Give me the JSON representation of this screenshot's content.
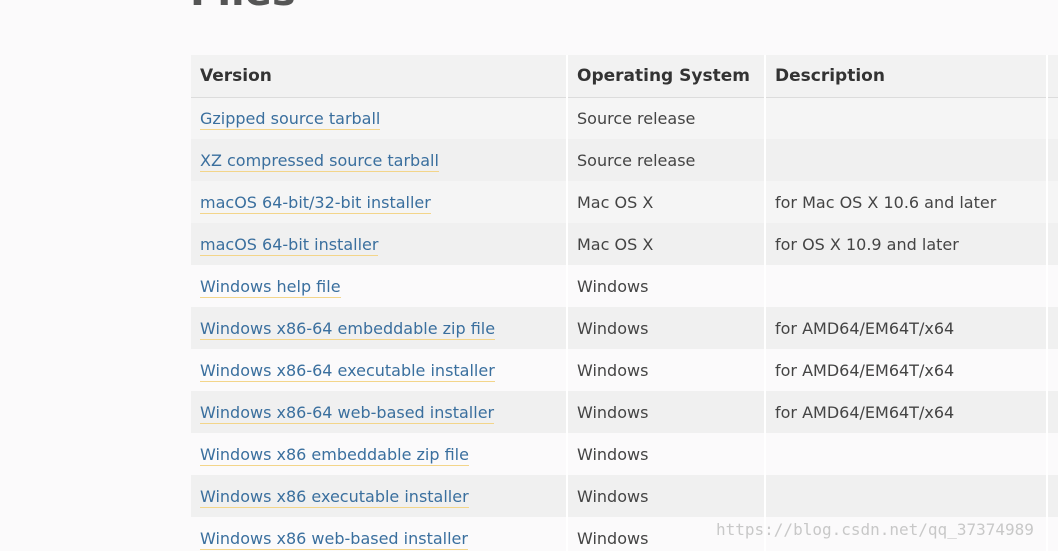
{
  "section": {
    "title": "Files"
  },
  "table": {
    "headers": [
      "Version",
      "Operating System",
      "Description",
      ""
    ],
    "rows": [
      {
        "version": "Gzipped source tarball",
        "os": "Source release",
        "description": ""
      },
      {
        "version": "XZ compressed source tarball",
        "os": "Source release",
        "description": ""
      },
      {
        "version": "macOS 64-bit/32-bit installer",
        "os": "Mac OS X",
        "description": "for Mac OS X 10.6 and later"
      },
      {
        "version": "macOS 64-bit installer",
        "os": "Mac OS X",
        "description": "for OS X 10.9 and later"
      },
      {
        "version": "Windows help file",
        "os": "Windows",
        "description": ""
      },
      {
        "version": "Windows x86-64 embeddable zip file",
        "os": "Windows",
        "description": "for AMD64/EM64T/x64"
      },
      {
        "version": "Windows x86-64 executable installer",
        "os": "Windows",
        "description": "for AMD64/EM64T/x64"
      },
      {
        "version": "Windows x86-64 web-based installer",
        "os": "Windows",
        "description": "for AMD64/EM64T/x64"
      },
      {
        "version": "Windows x86 embeddable zip file",
        "os": "Windows",
        "description": ""
      },
      {
        "version": "Windows x86 executable installer",
        "os": "Windows",
        "description": ""
      },
      {
        "version": "Windows x86 web-based installer",
        "os": "Windows",
        "description": ""
      }
    ]
  },
  "watermark": "https://blog.csdn.net/qq_37374989",
  "colors": {
    "link": "#3a6f9e",
    "link_underline": "#f3d58a",
    "header_bg": "#f2f2f2",
    "row_bg_a": "#f5f5f5",
    "row_bg_b": "#f0f0f0"
  }
}
